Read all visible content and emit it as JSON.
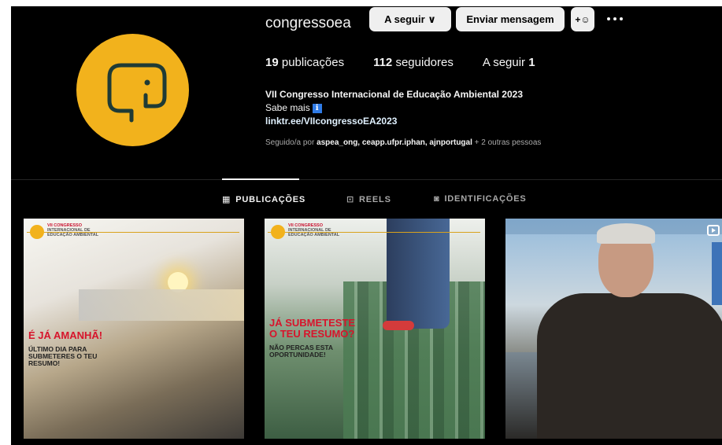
{
  "profile": {
    "username": "congressoea",
    "follow_label": "A seguir ∨",
    "message_label": "Enviar mensagem",
    "add_friend_label": "+ꔮ",
    "stats": {
      "posts_count": "19",
      "posts_label": "publicações",
      "followers_count": "112",
      "followers_label": "seguidores",
      "following_label": "A seguir",
      "following_count": "1"
    },
    "bio": {
      "name": "VII Congresso Internacional de Educação Ambiental 2023",
      "more": "Sabe mais",
      "info_badge": "ℹ",
      "link": "linktr.ee/VIIcongressoEA2023"
    },
    "followed_by": {
      "prefix": "Seguido/a por",
      "users": "aspea_ong, ceapp.ufpr.iphan, ajnportugal",
      "suffix": "+ 2 outras pessoas"
    },
    "brand_color": "#f2b21c"
  },
  "tabs": [
    {
      "label": "PUBLICAÇÕES",
      "icon": "grid-icon",
      "active": true
    },
    {
      "label": "REELS",
      "icon": "reels-icon",
      "active": false
    },
    {
      "label": "IDENTIFICAÇÕES",
      "icon": "tagged-icon",
      "active": false
    }
  ],
  "posts": [
    {
      "org_title": "VII CONGRESSO",
      "org_sub": "INTERNACIONAL DE EDUCAÇÃO AMBIENTAL",
      "headline": "É JÁ AMANHÃ!",
      "sub": "ÚLTIMO DIA PARA SUBMETERES O TEU RESUMO!"
    },
    {
      "org_title": "VII CONGRESSO",
      "org_sub": "INTERNACIONAL DE EDUCAÇÃO AMBIENTAL",
      "headline_1": "JÁ SUBMETESTE",
      "headline_2": "O TEU RESUMO?",
      "sub": "NÃO PERCAS ESTA OPORTUNIDADE!"
    },
    {
      "type": "reel",
      "icon": "reel-icon"
    }
  ]
}
